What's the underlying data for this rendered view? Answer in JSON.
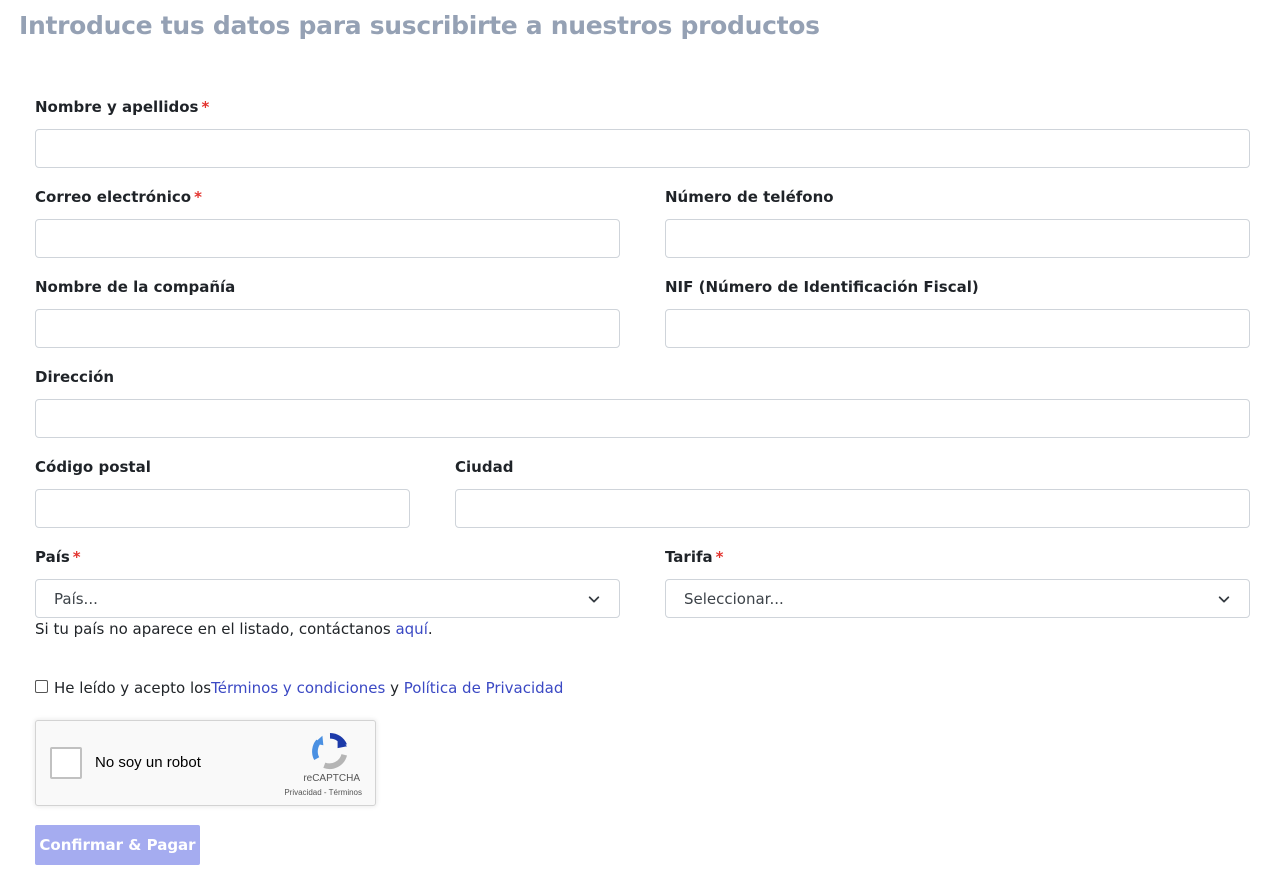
{
  "page": {
    "title": "Introduce tus datos para suscribirte a nuestros productos"
  },
  "form": {
    "full_name": {
      "label": "Nombre y apellidos",
      "required_mark": "*",
      "value": ""
    },
    "email": {
      "label": "Correo electrónico",
      "required_mark": "*",
      "value": ""
    },
    "phone": {
      "label": "Número de teléfono",
      "value": ""
    },
    "company": {
      "label": "Nombre de la compañía",
      "value": ""
    },
    "nif": {
      "label": "NIF (Número de Identificación Fiscal)",
      "value": ""
    },
    "address": {
      "label": "Dirección",
      "value": ""
    },
    "postal_code": {
      "label": "Código postal",
      "value": ""
    },
    "city": {
      "label": "Ciudad",
      "value": ""
    },
    "country": {
      "label": "País",
      "required_mark": "*",
      "selected": "País...",
      "icon": "chevron-down-icon"
    },
    "rate": {
      "label": "Tarifa",
      "required_mark": "*",
      "selected": "Seleccionar...",
      "icon": "chevron-down-icon"
    },
    "country_help": {
      "text": "Si tu país no aparece en el listado, contáctanos ",
      "link": "aquí",
      "suffix": "."
    },
    "terms": {
      "checked": false,
      "text_before": "He leído y acepto los ",
      "terms_link": "Términos y condiciones",
      "connector": " y ",
      "privacy_link": "Política de Privacidad"
    },
    "recaptcha": {
      "label": "No soy un robot",
      "brand": "reCAPTCHA",
      "privacy": "Privacidad",
      "separator": " - ",
      "terms": "Términos",
      "icon": "recaptcha-logo-icon"
    },
    "submit_label": "Confirmar & Pagar"
  },
  "colors": {
    "title": "#95a1b4",
    "required": "#e3342f",
    "link": "#3b49c4",
    "submit_bg": "#a5acf0",
    "input_border": "#cfd4da"
  }
}
